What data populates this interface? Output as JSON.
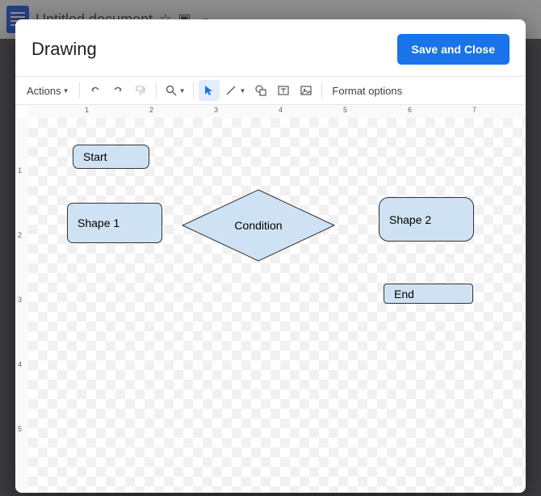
{
  "background": {
    "doc_title": "Untitled document"
  },
  "modal": {
    "title": "Drawing",
    "save_label": "Save and Close"
  },
  "toolbar": {
    "actions_label": "Actions",
    "format_label": "Format options"
  },
  "ruler_h": [
    "1",
    "2",
    "3",
    "4",
    "5",
    "6",
    "7"
  ],
  "ruler_v": [
    "1",
    "",
    "2",
    "",
    "3",
    "",
    "4",
    "",
    "5"
  ],
  "shapes": {
    "start": {
      "label": "Start"
    },
    "shape1": {
      "label": "Shape 1"
    },
    "condition": {
      "label": "Condition"
    },
    "shape2": {
      "label": "Shape 2"
    },
    "end": {
      "label": "End"
    }
  }
}
